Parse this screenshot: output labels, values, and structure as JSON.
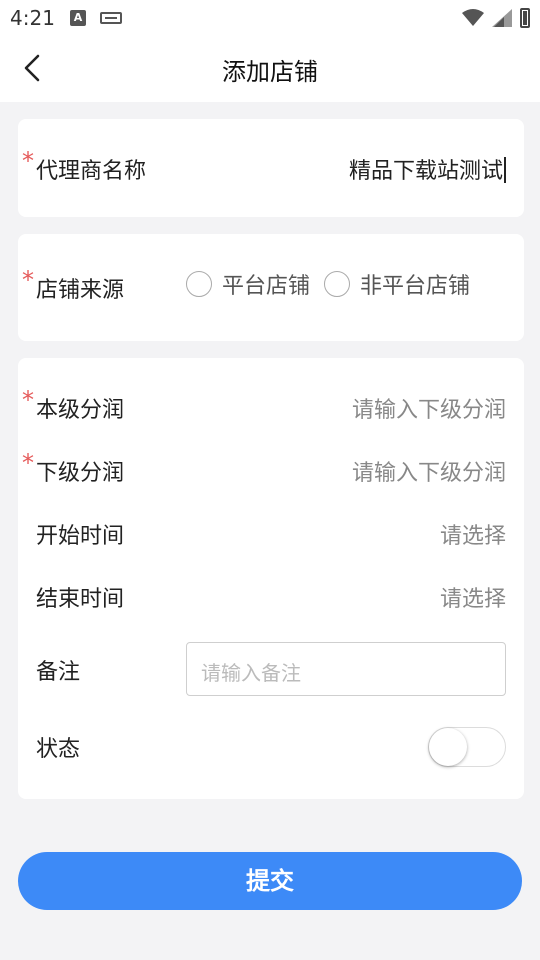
{
  "status_bar": {
    "time": "4:21",
    "a_badge": "A"
  },
  "header": {
    "title": "添加店铺"
  },
  "agent_name": {
    "required_mark": "*",
    "label": "代理商名称",
    "value": "精品下载站测试"
  },
  "shop_source": {
    "required_mark": "*",
    "label": "店铺来源",
    "options": [
      "平台店铺",
      "非平台店铺"
    ]
  },
  "details": {
    "own_share": {
      "required_mark": "*",
      "label": "本级分润",
      "placeholder": "请输入下级分润"
    },
    "sub_share": {
      "required_mark": "*",
      "label": "下级分润",
      "placeholder": "请输入下级分润"
    },
    "start_time": {
      "label": "开始时间",
      "placeholder": "请选择"
    },
    "end_time": {
      "label": "结束时间",
      "placeholder": "请选择"
    },
    "remark": {
      "label": "备注",
      "placeholder": "请输入备注"
    },
    "status": {
      "label": "状态",
      "enabled": false
    }
  },
  "submit_label": "提交",
  "colors": {
    "accent": "#3d8af7",
    "required": "#e55a5a",
    "background": "#f3f3f5"
  }
}
